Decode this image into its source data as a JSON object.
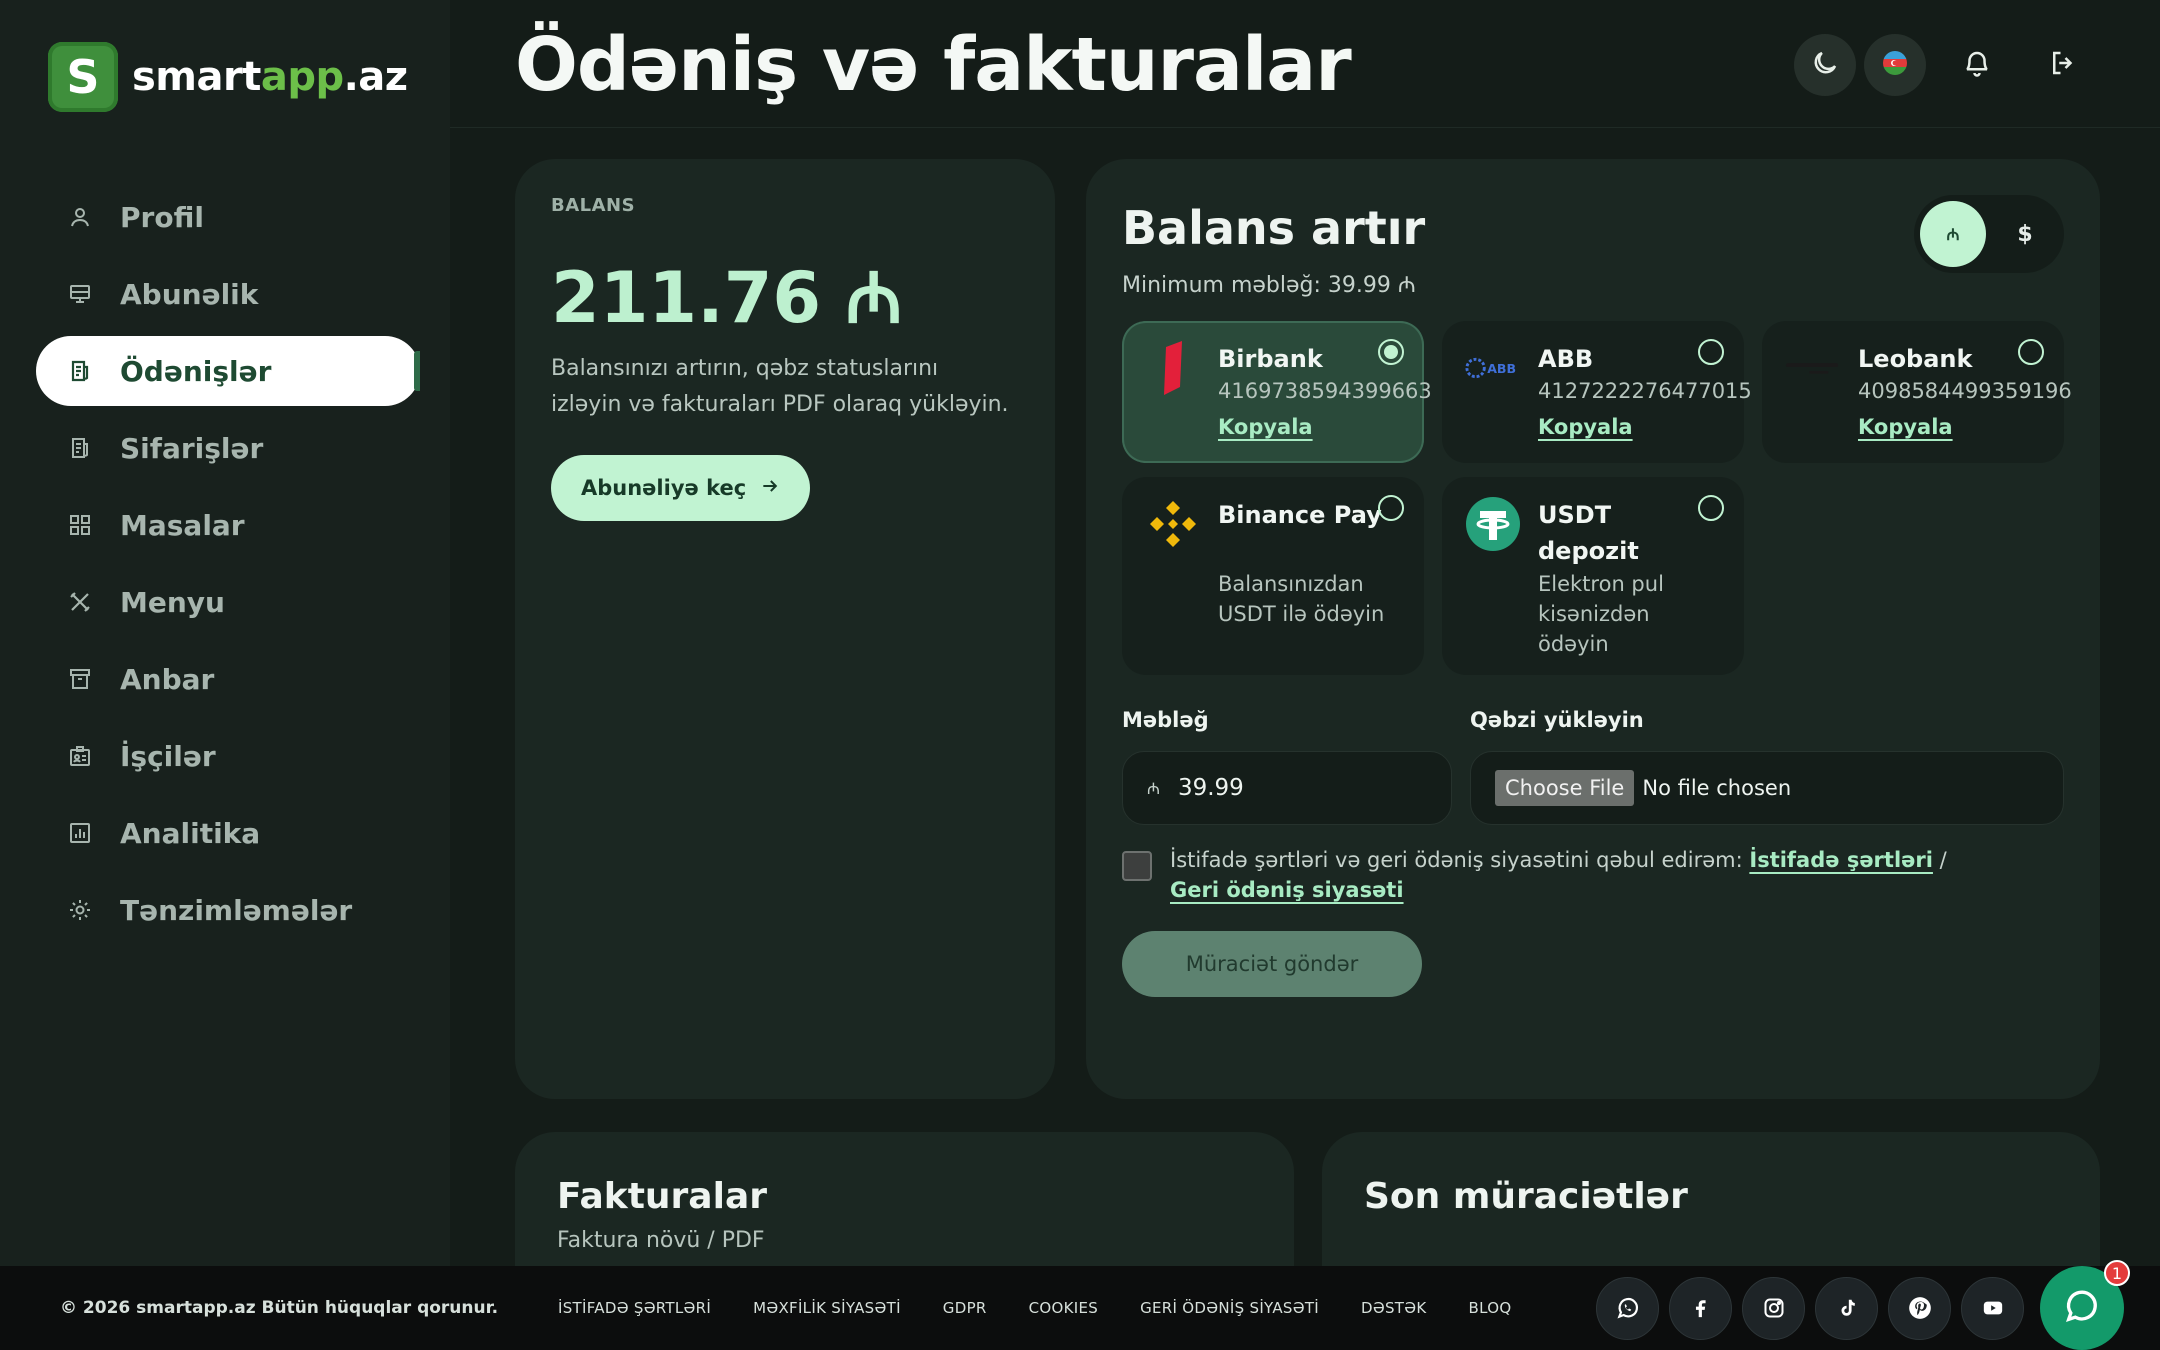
{
  "brand": {
    "mark": "S",
    "name_white_1": "smart",
    "name_green": "app",
    "name_white_2": ".az"
  },
  "sidebar": {
    "items": [
      {
        "label": "Profil",
        "icon": "user-icon",
        "active": false
      },
      {
        "label": "Abunəlik",
        "icon": "monitor-icon",
        "active": false
      },
      {
        "label": "Ödənişlər",
        "icon": "receipt-icon",
        "active": true
      },
      {
        "label": "Sifarişlər",
        "icon": "receipt-icon",
        "active": false
      },
      {
        "label": "Masalar",
        "icon": "grid-icon",
        "active": false
      },
      {
        "label": "Menyu",
        "icon": "utensils-icon",
        "active": false
      },
      {
        "label": "Anbar",
        "icon": "archive-icon",
        "active": false
      },
      {
        "label": "İşçilər",
        "icon": "id-badge-icon",
        "active": false
      },
      {
        "label": "Analitika",
        "icon": "chart-icon",
        "active": false
      },
      {
        "label": "Tənzimləmələr",
        "icon": "gear-icon",
        "active": false
      }
    ]
  },
  "header": {
    "title": "Ödəniş və fakturalar",
    "icons": [
      "moon-icon",
      "azerbaijan-flag-icon",
      "bell-icon",
      "logout-icon"
    ]
  },
  "balance": {
    "label": "BALANS",
    "amount": "211.76 ₼",
    "description": "Balansınızı artırın, qəbz statuslarını izləyin və fakturaları PDF olaraq yükləyin.",
    "button": "Abunəliyə keç"
  },
  "topup": {
    "title": "Balans artır",
    "minimum": "Minimum məbləğ: 39.99 ₼",
    "currency": {
      "azn": "₼",
      "usd": "$",
      "selected": "azn"
    },
    "methods": [
      {
        "name": "Birbank",
        "account": "4169738594399663",
        "copy": "Kopyala",
        "selected": true,
        "icon": "birbank-logo"
      },
      {
        "name": "ABB",
        "account": "4127222276477015",
        "copy": "Kopyala",
        "selected": false,
        "icon": "abb-logo"
      },
      {
        "name": "Leobank",
        "account": "4098584499359196",
        "copy": "Kopyala",
        "selected": false,
        "icon": "leobank-logo"
      },
      {
        "name": "Binance Pay",
        "description": "Balansınızdan USDT ilə ödəyin",
        "selected": false,
        "icon": "binance-logo"
      },
      {
        "name": "USDT depozit",
        "description": "Elektron pul kisənizdən ödəyin",
        "selected": false,
        "icon": "tether-logo"
      }
    ],
    "amount_label": "Məbləğ",
    "amount_value": "39.99",
    "amount_currency": "₼",
    "receipt_label": "Qəbzi yükləyin",
    "file_button": "Choose File",
    "file_status": "No file chosen",
    "terms_text": "İstifadə şərtləri və geri ödəniş siyasətini qəbul edirəm:",
    "terms_link": "İstifadə şərtləri",
    "terms_sep": "/",
    "refund_link": "Geri ödəniş siyasəti",
    "submit": "Müraciət göndər"
  },
  "invoices": {
    "title": "Fakturalar",
    "subtitle": "Faktura növü / PDF"
  },
  "requests": {
    "title": "Son müraciətlər"
  },
  "footer": {
    "copyright": "© 2026 smartapp.az Bütün hüquqlar qorunur.",
    "links": [
      "İSTİFADƏ ŞƏRTLƏRİ",
      "MƏXFİLİK SİYASƏTİ",
      "GDPR",
      "COOKIES",
      "GERİ ÖDƏNİŞ SİYASƏTİ",
      "DƏSTƏK",
      "BLOQ"
    ],
    "socials": [
      "whatsapp-icon",
      "facebook-icon",
      "instagram-icon",
      "tiktok-icon",
      "pinterest-icon",
      "youtube-icon"
    ],
    "chat_badge": "1"
  },
  "colors": {
    "accent": "#c1f3d2",
    "background": "#141c18",
    "card": "#1b2722",
    "brand_green": "#6cbf49"
  }
}
